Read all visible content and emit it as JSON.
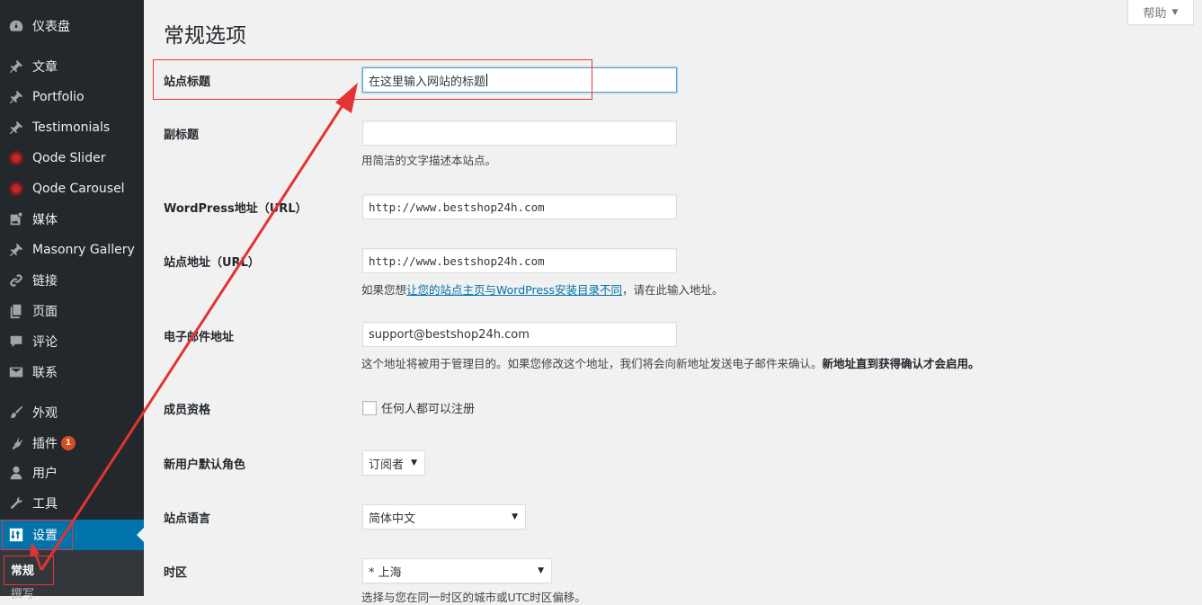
{
  "sidebar": {
    "items": [
      {
        "label": "仪表盘",
        "icon": "dashboard-icon"
      },
      {
        "label": "文章",
        "icon": "pin-icon"
      },
      {
        "label": "Portfolio",
        "icon": "pin-icon"
      },
      {
        "label": "Testimonials",
        "icon": "pin-icon"
      },
      {
        "label": "Qode Slider",
        "icon": "qode-circle-icon"
      },
      {
        "label": "Qode Carousel",
        "icon": "qode-circle-icon"
      },
      {
        "label": "媒体",
        "icon": "media-icon"
      },
      {
        "label": "Masonry Gallery",
        "icon": "pin-icon"
      },
      {
        "label": "链接",
        "icon": "link-icon"
      },
      {
        "label": "页面",
        "icon": "page-icon"
      },
      {
        "label": "评论",
        "icon": "comment-icon"
      },
      {
        "label": "联系",
        "icon": "mail-icon"
      },
      {
        "label": "外观",
        "icon": "brush-icon"
      },
      {
        "label": "插件",
        "icon": "plugin-icon",
        "badge": "1"
      },
      {
        "label": "用户",
        "icon": "user-icon"
      },
      {
        "label": "工具",
        "icon": "wrench-icon"
      },
      {
        "label": "设置",
        "icon": "settings-icon",
        "active": true
      }
    ],
    "submenu": [
      {
        "label": "常规",
        "current": true
      },
      {
        "label": "撰写"
      }
    ]
  },
  "header": {
    "title": "常规选项",
    "help_label": "帮助"
  },
  "form": {
    "site_title": {
      "label": "站点标题",
      "value": "在这里输入网站的标题"
    },
    "tagline": {
      "label": "副标题",
      "value": "",
      "desc": "用简洁的文字描述本站点。"
    },
    "wp_url": {
      "label": "WordPress地址（URL）",
      "value": "http://www.bestshop24h.com"
    },
    "site_url": {
      "label": "站点地址（URL）",
      "value": "http://www.bestshop24h.com",
      "desc_before": "如果您想",
      "desc_link": "让您的站点主页与WordPress安装目录不同",
      "desc_after": "，请在此输入地址。"
    },
    "email": {
      "label": "电子邮件地址",
      "value": "support@bestshop24h.com",
      "desc": "这个地址将被用于管理目的。如果您修改这个地址，我们将会向新地址发送电子邮件来确认。",
      "desc_bold": "新地址直到获得确认才会启用。"
    },
    "membership": {
      "label": "成员资格",
      "checkbox_label": "任何人都可以注册",
      "checked": false
    },
    "default_role": {
      "label": "新用户默认角色",
      "value": "订阅者"
    },
    "language": {
      "label": "站点语言",
      "value": "简体中文"
    },
    "timezone": {
      "label": "时区",
      "value": "* 上海",
      "desc": "选择与您在同一时区的城市或UTC时区偏移。"
    }
  },
  "colors": {
    "sidebar_bg": "#23282d",
    "accent": "#0073aa",
    "annotation": "#e33333"
  }
}
